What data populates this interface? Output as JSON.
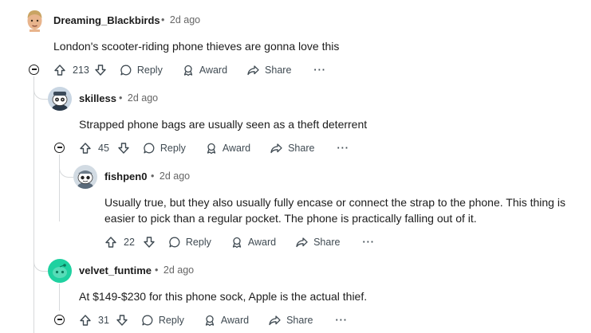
{
  "comments": [
    {
      "author": "Dreaming_Blackbirds",
      "time": "2d ago",
      "text": "London's scooter-riding phone thieves are gonna love this",
      "score": "213"
    },
    {
      "author": "skilless",
      "time": "2d ago",
      "text": "Strapped phone bags are usually seen as a theft deterrent",
      "score": "45"
    },
    {
      "author": "fishpen0",
      "time": "2d ago",
      "text_line1": "Usually true, but they also usually fully encase or connect the strap to the phone. This thing is",
      "text_line2": "easier to pick than a regular pocket. The phone is practically falling out of it.",
      "score": "22"
    },
    {
      "author": "velvet_funtime",
      "time": "2d ago",
      "text": "At $149-$230 for this phone sock, Apple is the actual thief.",
      "score": "31"
    }
  ],
  "actions": {
    "reply": "Reply",
    "award": "Award",
    "share": "Share",
    "more": "···",
    "separator": "•"
  },
  "icons": {
    "upvote": "upvote-icon",
    "downvote": "downvote-icon",
    "reply": "reply-bubble-icon",
    "award": "award-icon",
    "share": "share-arrow-icon",
    "collapse": "collapse-minus-icon"
  },
  "colors": {
    "thread_line": "#d7d9db",
    "action_text": "#3f4a52",
    "meta_text": "#666666",
    "velvet_avatar": "#1fd1a0"
  }
}
